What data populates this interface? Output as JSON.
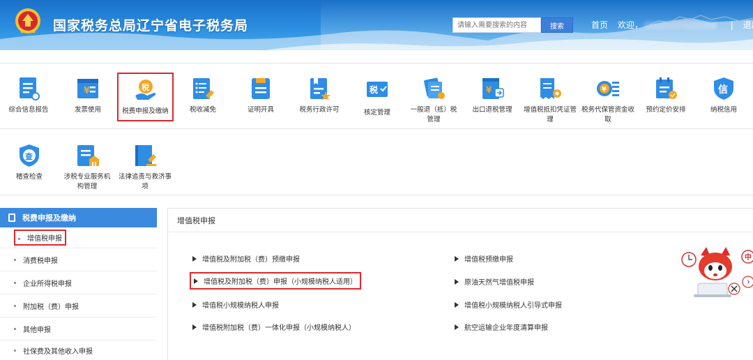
{
  "header": {
    "title": "国家税务总局辽宁省电子税务局",
    "search": {
      "placeholder": "请输入需要搜索的内容",
      "button": "搜索"
    },
    "links": {
      "home": "首页",
      "welcome": "欢迎，",
      "logout": "退出"
    }
  },
  "menu_row1": [
    {
      "label": "综合信息报告",
      "icon": "info-report-icon"
    },
    {
      "label": "发票使用",
      "icon": "invoice-icon"
    },
    {
      "label": "税费申报及缴纳",
      "icon": "tax-declare-pay-icon",
      "active": true
    },
    {
      "label": "税收减免",
      "icon": "tax-relief-icon"
    },
    {
      "label": "证明开具",
      "icon": "certificate-icon"
    },
    {
      "label": "税务行政许可",
      "icon": "admin-permit-icon"
    },
    {
      "label": "核定管理",
      "icon": "assessment-icon"
    },
    {
      "label": "一般退（抵）税管理",
      "icon": "tax-refund-icon"
    },
    {
      "label": "出口退税管理",
      "icon": "export-refund-icon"
    },
    {
      "label": "增值税抵扣凭证管理",
      "icon": "vat-voucher-icon"
    },
    {
      "label": "税务代保管资金收取",
      "icon": "fund-custody-icon"
    },
    {
      "label": "预约定价安排",
      "icon": "pricing-icon"
    },
    {
      "label": "纳税信用",
      "icon": "credit-icon"
    }
  ],
  "menu_row2": [
    {
      "label": "稽查检查",
      "icon": "inspection-icon"
    },
    {
      "label": "涉税专业服务机构管理",
      "icon": "service-org-icon"
    },
    {
      "label": "法律追责与救济事项",
      "icon": "legal-icon"
    }
  ],
  "sidebar": {
    "title": "税费申报及缴纳",
    "items": [
      {
        "label": "增值税申报",
        "active": true
      },
      {
        "label": "消费税申报"
      },
      {
        "label": "企业所得税申报"
      },
      {
        "label": "附加税（费）申报"
      },
      {
        "label": "其他申报"
      },
      {
        "label": "社保费及其他收入申报"
      }
    ]
  },
  "main": {
    "title": "增值税申报",
    "left_links": [
      {
        "label": "增值税及附加税（费）预缴申报"
      },
      {
        "label": "增值税及附加税（费）申报（小规模纳税人适用）",
        "active": true
      },
      {
        "label": "增值税小规模纳税人申报"
      },
      {
        "label": "增值税附加税（费）一体化申报（小规模纳税人）"
      }
    ],
    "right_links": [
      {
        "label": "增值税预缴申报"
      },
      {
        "label": "原油天然气增值税申报"
      },
      {
        "label": "增值税小规模纳税人引导式申报"
      },
      {
        "label": "航空运输企业年度清算申报"
      }
    ]
  },
  "mascot": {
    "char": "中"
  },
  "colors": {
    "brand": "#2b8ee0",
    "highlight": "#e0262b",
    "icon_blue": "#2f8de4",
    "icon_orange": "#f5a623"
  }
}
